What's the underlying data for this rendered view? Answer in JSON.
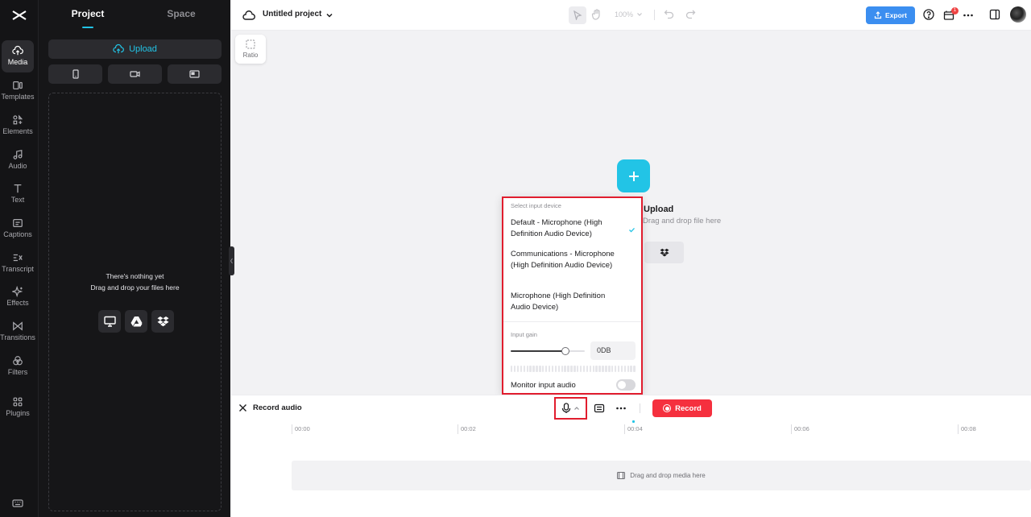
{
  "rail": {
    "items": [
      {
        "label": "Media",
        "icon": "cloud-upload-icon"
      },
      {
        "label": "Templates",
        "icon": "templates-icon"
      },
      {
        "label": "Elements",
        "icon": "elements-icon"
      },
      {
        "label": "Audio",
        "icon": "music-note-icon"
      },
      {
        "label": "Text",
        "icon": "text-icon"
      },
      {
        "label": "Captions",
        "icon": "captions-icon"
      },
      {
        "label": "Transcript",
        "icon": "transcript-icon"
      },
      {
        "label": "Effects",
        "icon": "sparkle-icon"
      },
      {
        "label": "Transitions",
        "icon": "transitions-icon"
      },
      {
        "label": "Filters",
        "icon": "filters-icon"
      },
      {
        "label": "Plugins",
        "icon": "plugins-icon"
      }
    ]
  },
  "panel": {
    "tabs": [
      {
        "label": "Project"
      },
      {
        "label": "Space"
      }
    ],
    "upload_label": "Upload",
    "empty_title": "There's nothing yet",
    "empty_subtitle": "Drag and drop your files here"
  },
  "topbar": {
    "title": "Untitled project",
    "zoom": "100%",
    "export_label": "Export",
    "notification_count": "1"
  },
  "canvas": {
    "ratio_label": "Ratio",
    "upload_title": "Upload",
    "upload_subtitle": "Drag and drop file here"
  },
  "input_popup": {
    "heading": "Select input device",
    "devices": [
      {
        "label": "Default - Microphone (High Definition Audio Device)",
        "selected": true
      },
      {
        "label": "Communications - Microphone (High Definition Audio Device)",
        "selected": false
      },
      {
        "label": "Microphone (High Definition Audio Device)",
        "selected": false
      }
    ],
    "gain_label": "Input gain",
    "gain_value": "0DB",
    "gain_level": 0.74,
    "monitor_label": "Monitor input audio",
    "monitor_on": false
  },
  "record_bar": {
    "title": "Record audio",
    "record_label": "Record"
  },
  "timeline": {
    "ticks": [
      "00:00",
      "00:02",
      "00:04",
      "00:06",
      "00:08"
    ],
    "drop_label": "Drag and drop media here"
  },
  "colors": {
    "accent": "#22c4e6",
    "export": "#3b8ef0",
    "record": "#f5303e",
    "highlight": "#e11d2e"
  }
}
